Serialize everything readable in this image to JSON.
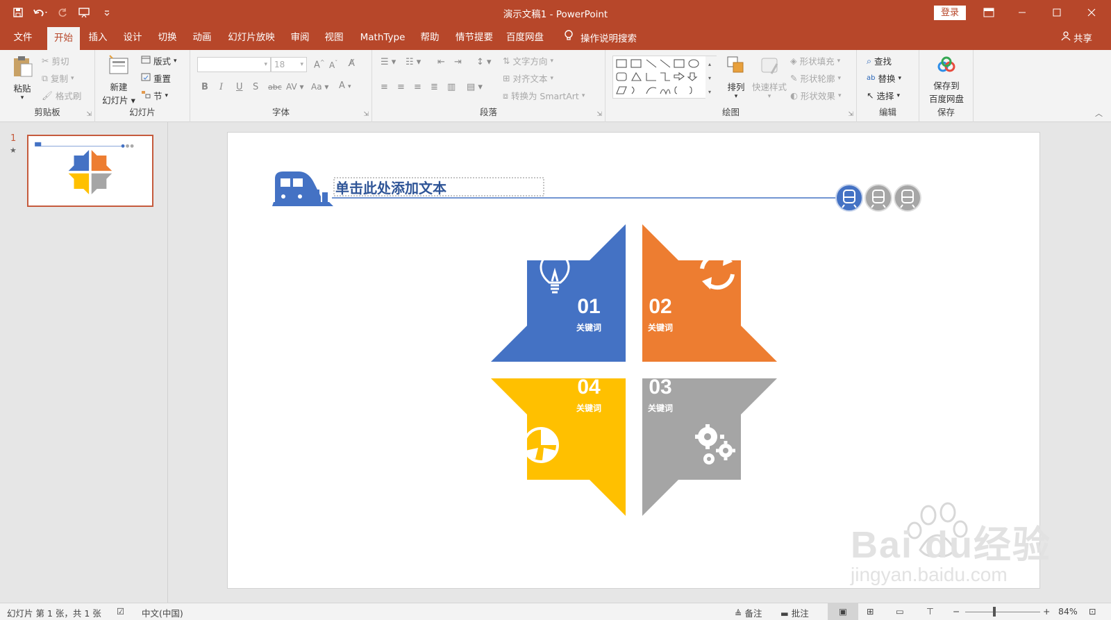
{
  "app": {
    "doc_title": "演示文稿1  -  PowerPoint",
    "login_label": "登录"
  },
  "menu": {
    "tabs": [
      "文件",
      "开始",
      "插入",
      "设计",
      "切换",
      "动画",
      "幻灯片放映",
      "审阅",
      "视图",
      "MathType",
      "帮助",
      "情节提要",
      "百度网盘"
    ],
    "active_tab": "开始",
    "search_label": "操作说明搜索",
    "share_label": "共享"
  },
  "ribbon": {
    "clipboard": {
      "paste": "粘贴",
      "cut": "剪切",
      "copy": "复制",
      "format_painter": "格式刷",
      "group": "剪贴板"
    },
    "slides": {
      "new_slide_line1": "新建",
      "new_slide_line2": "幻灯片",
      "layout": "版式",
      "reset": "重置",
      "section": "节",
      "group": "幻灯片"
    },
    "font": {
      "font_size": "18",
      "group": "字体",
      "bold": "B",
      "italic": "I",
      "underline": "U",
      "shadow": "S",
      "strike": "abc",
      "spacing": "AV",
      "case": "Aa",
      "color": "A"
    },
    "paragraph": {
      "text_direction": "文字方向",
      "align_text": "对齐文本",
      "smartart": "转换为 SmartArt",
      "group": "段落"
    },
    "drawing": {
      "arrange": "排列",
      "quick_styles": "快速样式",
      "shape_fill": "形状填充",
      "shape_outline": "形状轮廓",
      "shape_effects": "形状效果",
      "group": "绘图"
    },
    "editing": {
      "find": "查找",
      "replace": "替换",
      "select": "选择",
      "group": "编辑"
    },
    "save": {
      "line1": "保存到",
      "line2": "百度网盘",
      "group": "保存"
    }
  },
  "slide_panel": {
    "slide_number": "1"
  },
  "slide": {
    "title_placeholder": "单击此处添加文本",
    "quadrants": [
      {
        "number": "01",
        "label": "关键词",
        "color": "#4472c4",
        "icon": "lightbulb-icon"
      },
      {
        "number": "02",
        "label": "关键词",
        "color": "#ed7d31",
        "icon": "refresh-icon"
      },
      {
        "number": "03",
        "label": "关键词",
        "color": "#a5a5a5",
        "icon": "gears-icon"
      },
      {
        "number": "04",
        "label": "关键词",
        "color": "#ffc000",
        "icon": "pie-chart-icon"
      }
    ],
    "accent_color": "#4472c4"
  },
  "status": {
    "slide_info": "幻灯片 第 1 张，共 1 张",
    "language": "中文(中国)",
    "notes": "备注",
    "comments": "批注",
    "zoom": "84%"
  },
  "watermark": {
    "brand": "Bai  du经验",
    "url": "jingyan.baidu.com"
  }
}
